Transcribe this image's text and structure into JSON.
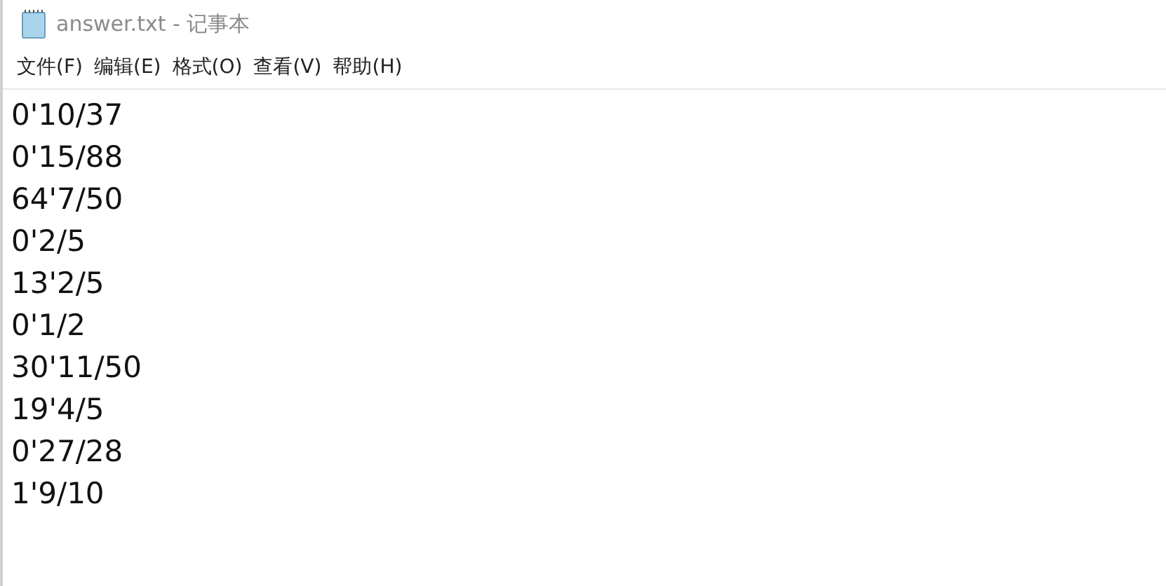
{
  "window": {
    "title": "answer.txt - 记事本"
  },
  "menu": [
    "文件(F)",
    "编辑(E)",
    "格式(O)",
    "查看(V)",
    "帮助(H)"
  ],
  "lines": [
    "0'10/37",
    "0'15/88",
    "64'7/50",
    "0'2/5",
    "13'2/5",
    "0'1/2",
    "30'11/50",
    "19'4/5",
    "0'27/28",
    "1'9/10"
  ]
}
